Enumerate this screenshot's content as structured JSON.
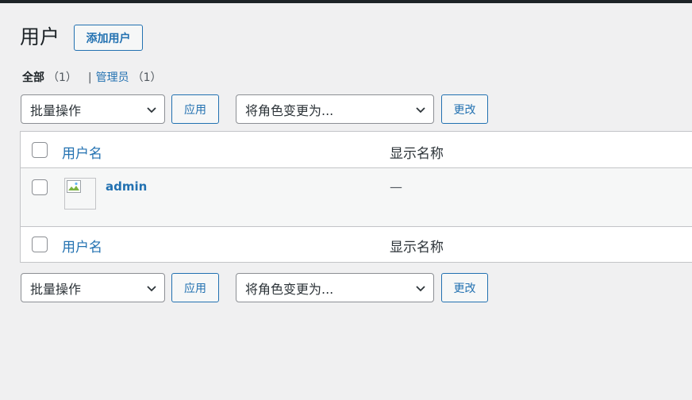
{
  "header": {
    "title": "用户",
    "add_new_label": "添加用户"
  },
  "filters": [
    {
      "label": "全部",
      "count": "（1）",
      "current": true
    },
    {
      "separator": "|",
      "label": "管理员",
      "count": "（1）",
      "current": false
    }
  ],
  "bulk_actions": {
    "selected": "批量操作",
    "apply_label": "应用"
  },
  "change_role": {
    "selected": "将角色变更为...",
    "change_label": "更改"
  },
  "table": {
    "columns": [
      "用户名",
      "显示名称"
    ],
    "rows": [
      {
        "username": "admin",
        "display_name": "—"
      }
    ]
  },
  "icons": {
    "dropdown": "chevron-down-icon",
    "avatar": "broken-image-icon"
  },
  "colors": {
    "accent": "#2271b1",
    "background": "#f0f0f1",
    "admin_bar": "#1d2327"
  }
}
